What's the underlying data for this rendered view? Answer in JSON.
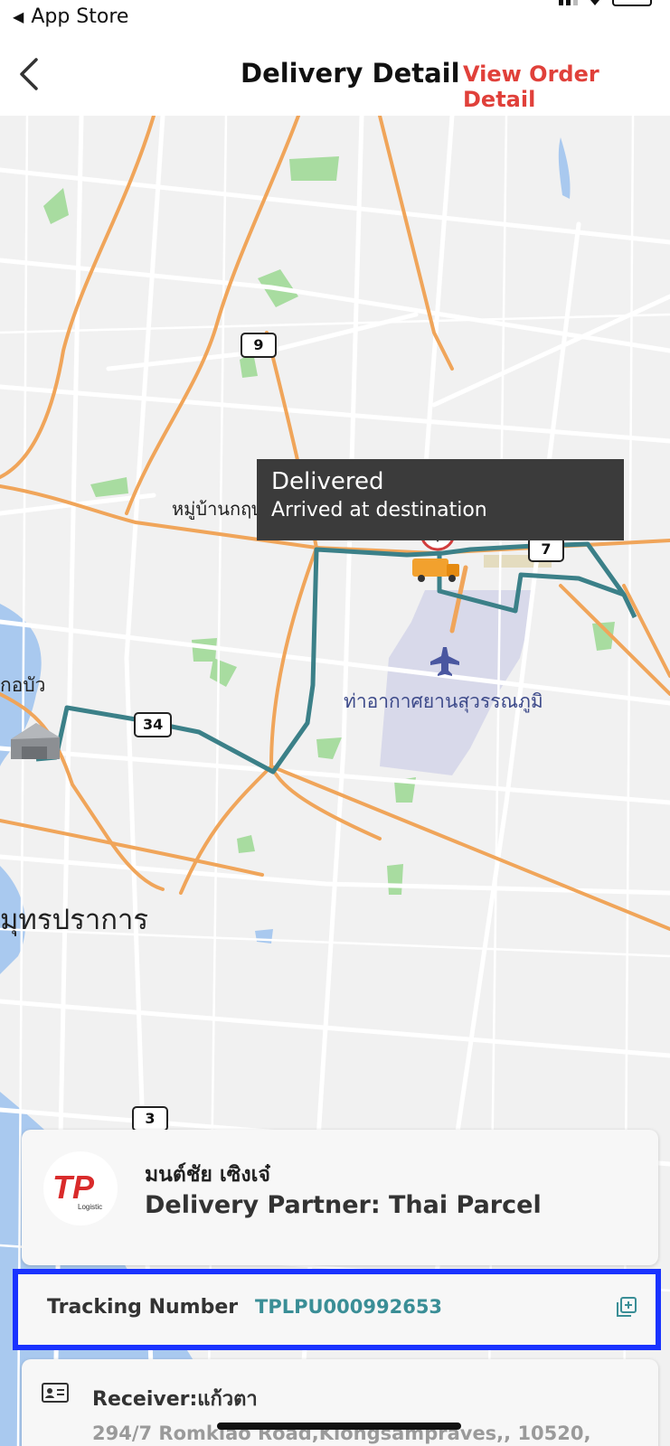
{
  "status_bar": {
    "back_label": "App Store"
  },
  "nav": {
    "title": "Delivery Detail",
    "action": "View Order Detail"
  },
  "map": {
    "labels": {
      "village": "หมู่บ้านกฤษ ไพรเวทซิตี้",
      "airport": "ท่าอากาศยานสุวรรณภูมิ",
      "kob": "กอบัว",
      "city": "มุทรปราการ"
    },
    "route_shields": [
      "9",
      "7",
      "34",
      "3"
    ],
    "tooltip": {
      "status": "Delivered",
      "detail": "Arrived at destination"
    },
    "route_color": "#3b8088"
  },
  "partner": {
    "name": "มนต์ชัย เซิงเจ๋",
    "label": "Delivery Partner: Thai Parcel",
    "logo_text": "TP",
    "logo_sub": "Logistic"
  },
  "tracking": {
    "label": "Tracking Number",
    "number": "TPLPU000992653",
    "highlight_color": "#1a33ff"
  },
  "receiver": {
    "label": "Receiver:แก้วตา",
    "address": "294/7 Romklao Road,Klongsampraves,, 10520,"
  }
}
